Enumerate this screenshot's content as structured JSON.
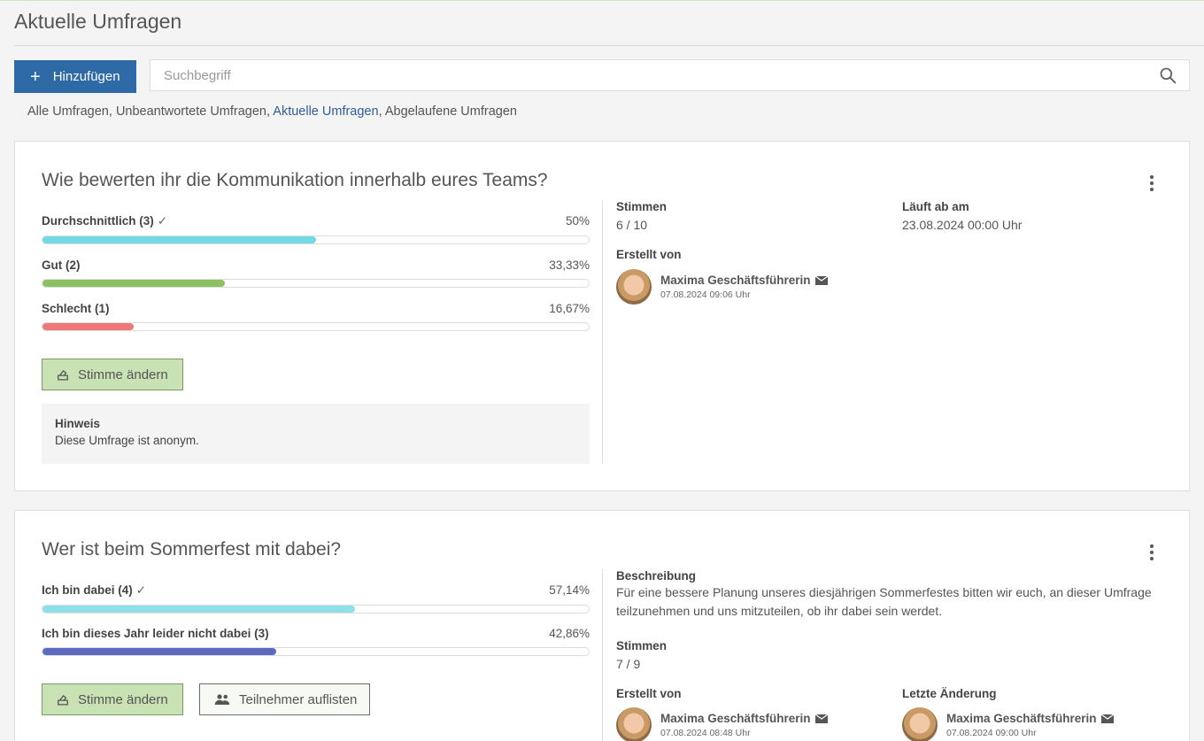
{
  "page": {
    "title": "Aktuelle Umfragen"
  },
  "toolbar": {
    "add_label": "Hinzufügen",
    "search_placeholder": "Suchbegriff"
  },
  "filters": [
    {
      "label": "Alle Umfragen",
      "active": false
    },
    {
      "label": "Unbeantwortete Umfragen",
      "active": false
    },
    {
      "label": "Aktuelle Umfragen",
      "active": true
    },
    {
      "label": "Abgelaufene Umfragen",
      "active": false
    }
  ],
  "colors": {
    "primary": "#2d6aa6",
    "link_active": "#2d5e9a",
    "vote_button_bg": "#c8e2b4"
  },
  "polls": [
    {
      "question": "Wie bewerten ihr die Kommunikation innerhalb eures Teams?",
      "options": [
        {
          "label": "Durchschnittlich (3)",
          "voted": true,
          "percent_label": "50%",
          "fraction": 0.5,
          "color": "#73d9e6"
        },
        {
          "label": "Gut (2)",
          "voted": false,
          "percent_label": "33,33%",
          "fraction": 0.3333,
          "color": "#8bc063"
        },
        {
          "label": "Schlecht (1)",
          "voted": false,
          "percent_label": "16,67%",
          "fraction": 0.1667,
          "color": "#ee7777"
        }
      ],
      "change_vote_label": "Stimme ändern",
      "hint": {
        "title": "Hinweis",
        "text": "Diese Umfrage ist anonym."
      },
      "votes": {
        "label": "Stimmen",
        "value": "6 / 10"
      },
      "expires": {
        "label": "Läuft ab am",
        "value": "23.08.2024 00:00 Uhr"
      },
      "created_by": {
        "label": "Erstellt von",
        "name": "Maxima Geschäftsführerin",
        "date": "07.08.2024 09:06 Uhr"
      }
    },
    {
      "question": "Wer ist beim Sommerfest mit dabei?",
      "options": [
        {
          "label": "Ich bin dabei (4)",
          "voted": true,
          "percent_label": "57,14%",
          "fraction": 0.5714,
          "color": "#8ce0e8"
        },
        {
          "label": "Ich bin dieses Jahr leider nicht dabei (3)",
          "voted": false,
          "percent_label": "42,86%",
          "fraction": 0.4286,
          "color": "#5c6bc0"
        }
      ],
      "change_vote_label": "Stimme ändern",
      "list_participants_label": "Teilnehmer auflisten",
      "description": {
        "label": "Beschreibung",
        "text": "Für eine bessere Planung unseres diesjährigen Sommerfestes bitten wir euch, an dieser Umfrage teilzunehmen und uns mitzuteilen, ob ihr dabei sein werdet."
      },
      "votes": {
        "label": "Stimmen",
        "value": "7 / 9"
      },
      "created_by": {
        "label": "Erstellt von",
        "name": "Maxima Geschäftsführerin",
        "date": "07.08.2024 08:48 Uhr"
      },
      "last_change": {
        "label": "Letzte Änderung",
        "name": "Maxima Geschäftsführerin",
        "date": "07.08.2024 09:00 Uhr"
      }
    }
  ],
  "icons": {
    "add": "plus-icon",
    "search": "search-icon",
    "check": "check-icon",
    "menu": "more-vertical-icon",
    "vote": "ballot-icon",
    "participants": "people-icon",
    "mail": "mail-icon"
  }
}
